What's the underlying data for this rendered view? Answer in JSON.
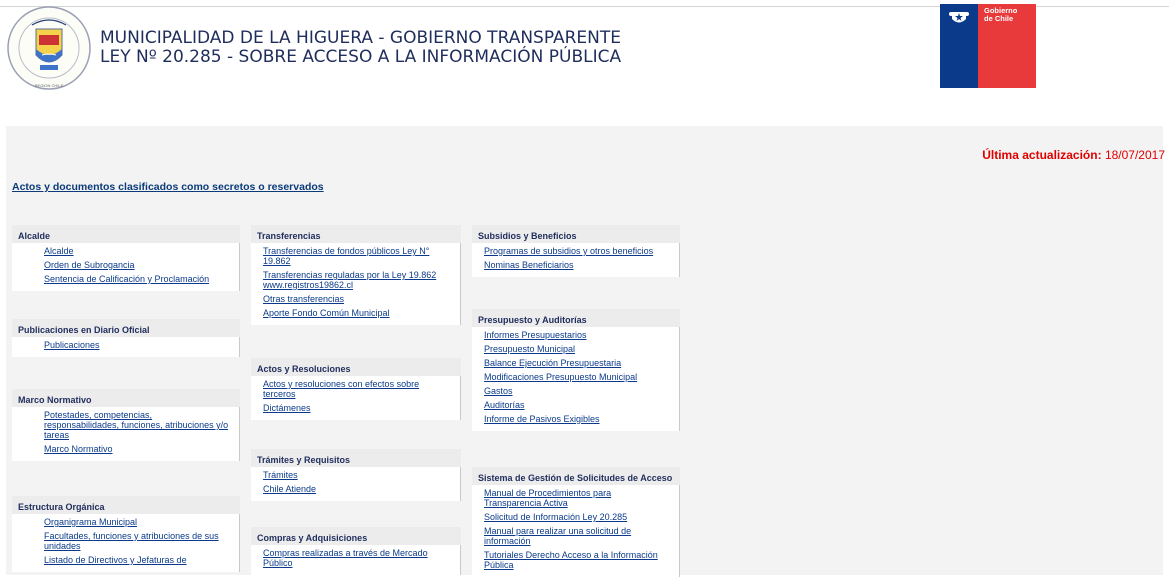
{
  "header": {
    "title_line1": "MUNICIPALIDAD DE LA HIGUERA - GOBIERNO TRANSPARENTE",
    "title_line2": "LEY Nº 20.285 - SOBRE ACCESO A LA INFORMACIÓN PÚBLICA",
    "seal_text": "ILUSTRE MUNICIPALIDAD DE LA HIGUERA · CUARTA REGION CHILE",
    "gob_text_line1": "Gobierno",
    "gob_text_line2": "de Chile"
  },
  "update": {
    "label": "Última actualización:",
    "date": "18/07/2017"
  },
  "secret_link": "Actos y documentos clasificados como secretos o reservados",
  "col1": [
    {
      "title": "Alcalde",
      "links": [
        "Alcalde",
        "Orden de Subrogancia",
        "Sentencia de Calificación y Proclamación"
      ]
    },
    {
      "title": "Publicaciones en Diario Oficial",
      "links": [
        "Publicaciones"
      ]
    },
    {
      "title": "Marco Normativo",
      "links": [
        "Potestades, competencias, responsabilidades, funciones, atribuciones y/o tareas",
        "Marco Normativo"
      ]
    },
    {
      "title": "Estructura Orgánica",
      "links": [
        "Organigrama Municipal",
        "Facultades, funciones y atribuciones de sus unidades",
        "Listado de Directivos y Jefaturas de"
      ]
    }
  ],
  "col2": [
    {
      "title": "Transferencias",
      "links": [
        "Transferencias de fondos públicos Ley N° 19.862",
        "Transferencias reguladas por la Ley 19.862 www.registros19862.cl",
        "Otras transferencias",
        "Aporte Fondo Común Municipal"
      ]
    },
    {
      "title": "Actos y Resoluciones",
      "links": [
        "Actos y resoluciones con efectos sobre terceros",
        "Dictámenes"
      ]
    },
    {
      "title": "Trámites y Requisitos",
      "links": [
        "Trámites",
        "Chile Atiende"
      ]
    },
    {
      "title": "Compras y Adquisiciones",
      "links": [
        "Compras realizadas a través de Mercado Público"
      ]
    }
  ],
  "col3": [
    {
      "title": "Subsidios y Beneficios",
      "links": [
        "Programas de subsidios y otros beneficios",
        "Nominas Beneficiarios"
      ]
    },
    {
      "title": "Presupuesto y Auditorías",
      "links": [
        "Informes Presupuestarios",
        "Presupuesto Municipal",
        "Balance Ejecución Presupuestaria",
        "Modificaciones Presupuesto Municipal",
        "Gastos",
        "Auditorías",
        "Informe de Pasivos Exigibles"
      ]
    },
    {
      "title": "Sistema de Gestión de Solicitudes de Acceso",
      "links": [
        "Manual de Procedimientos para Transparencia Activa",
        "Solicitud de Información Ley 20.285",
        "Manual para realizar una solicitud de información",
        "Tutoriales Derecho Acceso a la Información Pública"
      ]
    }
  ],
  "colors": {
    "link": "#0b3a8a",
    "header_text": "#1f2d5c",
    "update_red": "#e00000",
    "gob_blue": "#0b3a8a",
    "gob_red": "#e83a3a"
  }
}
